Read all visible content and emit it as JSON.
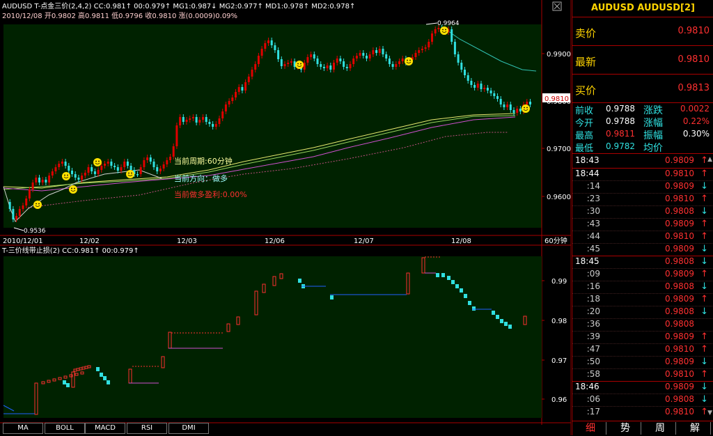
{
  "chart_header": {
    "line1": "AUDUSD  T-点金三价(2,4,2)  CC:0.981↑  00:0.979↑  MG1:0.987↓  MG2:0.977↑  MD1:0.978↑  MD2:0.978↑",
    "line2": "2010/12/08  开0.9802  高0.9811  低0.9796  收0.9810  涨(0.0009)0.09%"
  },
  "main_chart": {
    "y_ticks": [
      "0.9900",
      "0.9800",
      "0.9700",
      "0.9600"
    ],
    "x_ticks": [
      "2010/12/01",
      "12/02",
      "12/03",
      "12/06",
      "12/07",
      "12/08"
    ],
    "period_label": "60分钟",
    "annotation_high": "0.9964",
    "annotation_low": "0.9536",
    "current_price_tag": "0.9810",
    "info_period": "当前周期:60分钟",
    "info_direction": "当前方向：做多",
    "info_profit": "当前做多盈利:0.00%",
    "colors": {
      "bg": "#002200",
      "up": "#e00000",
      "down": "#30e0e0"
    }
  },
  "sub_chart": {
    "title": "T-三价线带止损(2)  CC:0.981↑  00:0.979↑",
    "y_ticks": [
      "0.99",
      "0.98",
      "0.97",
      "0.96"
    ]
  },
  "bottom_tabs": [
    "MA",
    "BOLL",
    "MACD",
    "RSI",
    "DMI"
  ],
  "side": {
    "title": "AUDUSD AUDUSD[2]",
    "sell_label": "卖价",
    "sell_value": "0.9810",
    "last_label": "最新",
    "last_value": "0.9810",
    "buy_label": "买价",
    "buy_value": "0.9813",
    "stats": {
      "prev_close_label": "前收",
      "prev_close": "0.9788",
      "change_label": "涨跌",
      "change": "0.0022",
      "open_label": "今开",
      "open": "0.9788",
      "change_pct_label": "涨幅",
      "change_pct": "0.22%",
      "high_label": "最高",
      "high": "0.9811",
      "amplitude_label": "振幅",
      "amplitude": "0.30%",
      "low_label": "最低",
      "low": "0.9782",
      "avg_label": "均价",
      "avg": ""
    },
    "ticks": [
      {
        "time": "18:43",
        "price": "0.9809",
        "dir": "up",
        "main": true
      },
      {
        "time": "18:44",
        "price": "0.9810",
        "dir": "up",
        "main": true
      },
      {
        "time": ":14",
        "price": "0.9809",
        "dir": "down"
      },
      {
        "time": ":23",
        "price": "0.9810",
        "dir": "up"
      },
      {
        "time": ":30",
        "price": "0.9808",
        "dir": "down"
      },
      {
        "time": ":43",
        "price": "0.9809",
        "dir": "up"
      },
      {
        "time": ":44",
        "price": "0.9810",
        "dir": "up"
      },
      {
        "time": ":45",
        "price": "0.9809",
        "dir": "down"
      },
      {
        "time": "18:45",
        "price": "0.9808",
        "dir": "down",
        "main": true
      },
      {
        "time": ":09",
        "price": "0.9809",
        "dir": "up"
      },
      {
        "time": ":16",
        "price": "0.9808",
        "dir": "down"
      },
      {
        "time": ":18",
        "price": "0.9809",
        "dir": "up"
      },
      {
        "time": ":20",
        "price": "0.9808",
        "dir": "down"
      },
      {
        "time": ":36",
        "price": "0.9808",
        "dir": ""
      },
      {
        "time": ":39",
        "price": "0.9809",
        "dir": "up"
      },
      {
        "time": ":47",
        "price": "0.9810",
        "dir": "up"
      },
      {
        "time": ":50",
        "price": "0.9809",
        "dir": "down"
      },
      {
        "time": ":58",
        "price": "0.9810",
        "dir": "up"
      },
      {
        "time": "18:46",
        "price": "0.9809",
        "dir": "down",
        "main": true
      },
      {
        "time": ":06",
        "price": "0.9808",
        "dir": "down"
      },
      {
        "time": ":17",
        "price": "0.9810",
        "dir": "up"
      }
    ],
    "side_tabs": [
      "细",
      "势",
      "周",
      "解"
    ]
  }
}
